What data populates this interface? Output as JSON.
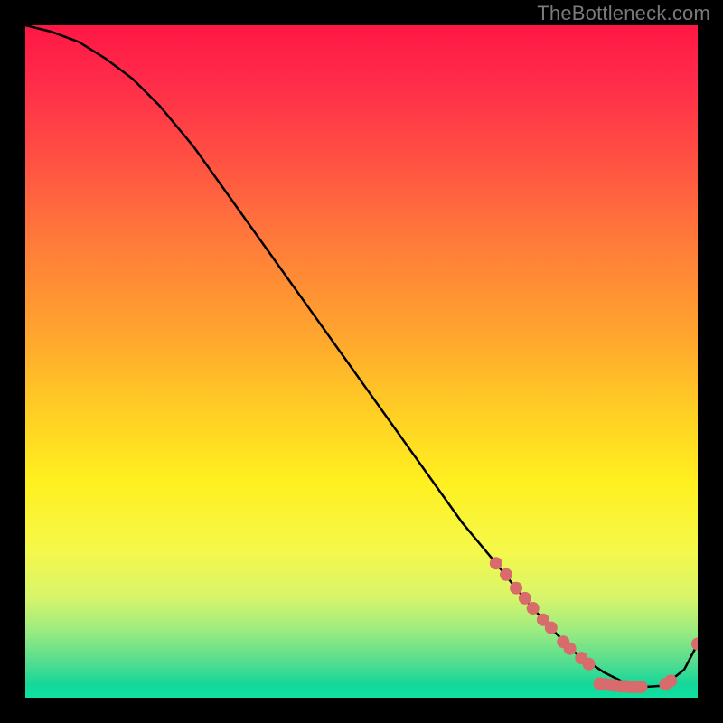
{
  "watermark": "TheBottleneck.com",
  "chart_data": {
    "type": "line",
    "title": "",
    "xlabel": "",
    "ylabel": "",
    "xlim": [
      0,
      100
    ],
    "ylim": [
      0,
      100
    ],
    "grid": false,
    "series": [
      {
        "name": "curve",
        "color": "#000000",
        "x": [
          0,
          4,
          8,
          12,
          16,
          20,
          25,
          30,
          35,
          40,
          45,
          50,
          55,
          60,
          65,
          70,
          74,
          78,
          82,
          86,
          89,
          92,
          95,
          98,
          100
        ],
        "y": [
          100,
          99,
          97.5,
          95,
          92,
          88,
          82,
          75,
          68,
          61,
          54,
          47,
          40,
          33,
          26,
          20,
          15,
          10.5,
          6.5,
          3.8,
          2.3,
          1.6,
          1.8,
          4.2,
          8
        ]
      }
    ],
    "markers": [
      {
        "name": "dots",
        "color": "#d86b6b",
        "radius": 7,
        "points": [
          {
            "x": 70,
            "y": 20
          },
          {
            "x": 71.5,
            "y": 18.3
          },
          {
            "x": 73,
            "y": 16.3
          },
          {
            "x": 74.3,
            "y": 14.8
          },
          {
            "x": 75.5,
            "y": 13.3
          },
          {
            "x": 77,
            "y": 11.6
          },
          {
            "x": 78.2,
            "y": 10.4
          },
          {
            "x": 80,
            "y": 8.3
          },
          {
            "x": 81,
            "y": 7.3
          },
          {
            "x": 82.7,
            "y": 5.9
          },
          {
            "x": 83.8,
            "y": 5
          },
          {
            "x": 85.4,
            "y": 2.1
          },
          {
            "x": 86.2,
            "y": 2
          },
          {
            "x": 87,
            "y": 1.9
          },
          {
            "x": 87.8,
            "y": 1.8
          },
          {
            "x": 88.6,
            "y": 1.7
          },
          {
            "x": 89.4,
            "y": 1.7
          },
          {
            "x": 90.1,
            "y": 1.6
          },
          {
            "x": 90.8,
            "y": 1.6
          },
          {
            "x": 91.6,
            "y": 1.6
          },
          {
            "x": 95.2,
            "y": 2
          },
          {
            "x": 96,
            "y": 2.5
          },
          {
            "x": 100,
            "y": 8
          }
        ]
      }
    ]
  }
}
